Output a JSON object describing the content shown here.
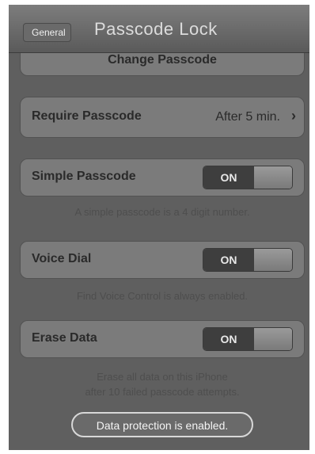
{
  "navbar": {
    "back_label": "General",
    "title": "Passcode Lock"
  },
  "change_passcode": {
    "label": "Change Passcode"
  },
  "require_passcode": {
    "label": "Require Passcode",
    "value": "After 5 min."
  },
  "simple_passcode": {
    "label": "Simple Passcode",
    "toggle": "ON",
    "footer": "A simple passcode is a 4 digit number."
  },
  "voice_dial": {
    "label": "Voice Dial",
    "toggle": "ON",
    "footer": "Find Voice Control is always enabled."
  },
  "erase_data": {
    "label": "Erase Data",
    "toggle": "ON",
    "footer_line1": "Erase all data on this iPhone",
    "footer_line2": "after 10 failed passcode attempts."
  },
  "status": {
    "text": "Data protection is enabled."
  }
}
